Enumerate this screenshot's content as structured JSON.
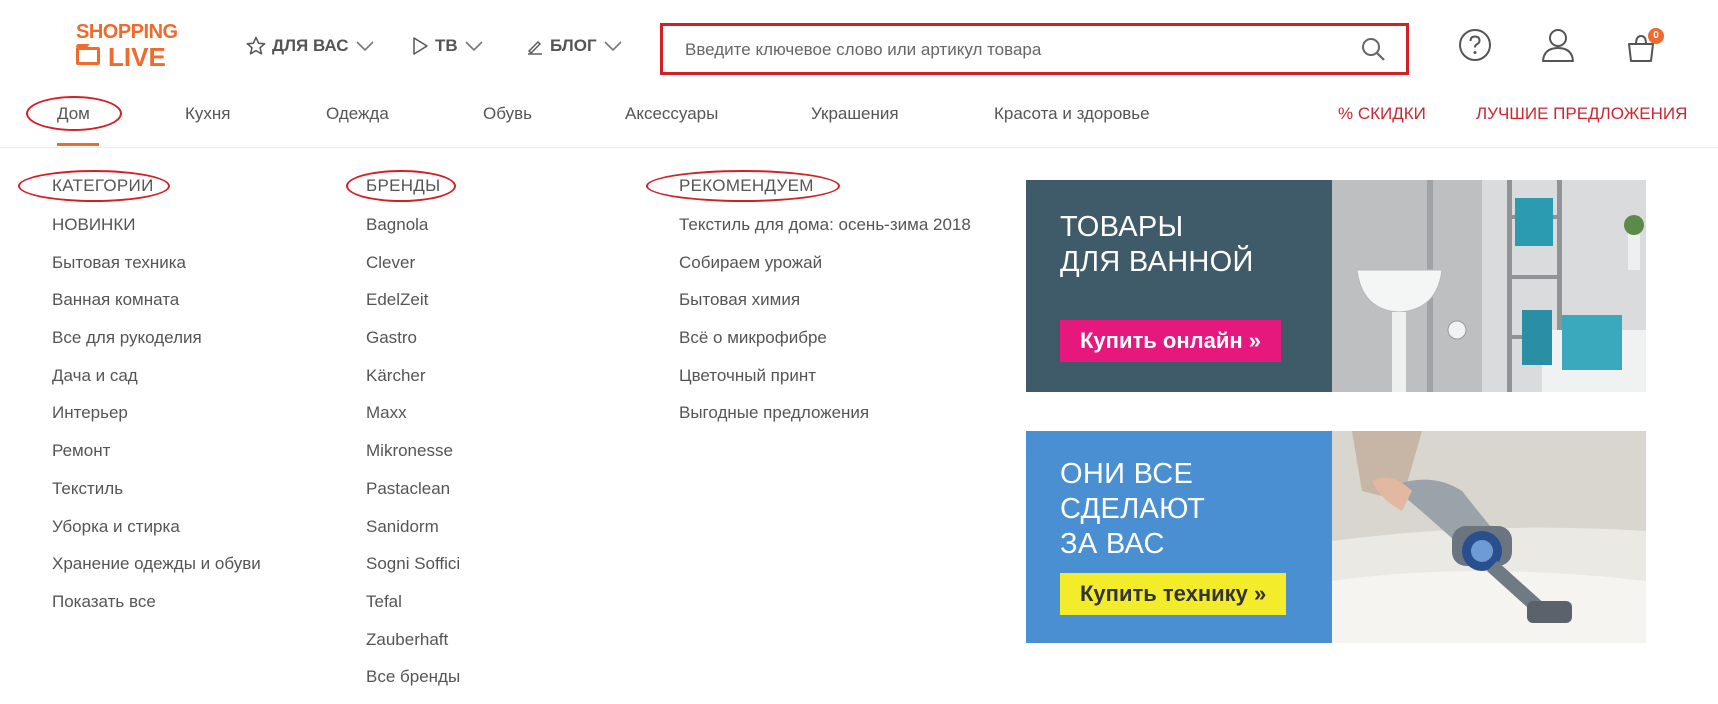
{
  "logo": {
    "line1": "SHOPPING",
    "line2": "LIVE"
  },
  "topnav": [
    {
      "label": "ДЛЯ ВАС",
      "icon": "star-icon"
    },
    {
      "label": "ТВ",
      "icon": "play-icon"
    },
    {
      "label": "БЛОГ",
      "icon": "pencil-icon"
    }
  ],
  "search": {
    "placeholder": "Введите ключевое слово или артикул товара"
  },
  "cart": {
    "count": "0"
  },
  "categories": [
    "Дом",
    "Кухня",
    "Одежда",
    "Обувь",
    "Аксессуары",
    "Украшения",
    "Красота и здоровье"
  ],
  "promo": {
    "discounts": "% СКИДКИ",
    "best": "ЛУЧШИЕ ПРЕДЛОЖЕНИЯ"
  },
  "colors": {
    "accent": "#ee6a2d",
    "promo": "#cc2630",
    "highlight": "#d32027"
  },
  "menu": {
    "categories": {
      "heading": "КАТЕГОРИИ",
      "items": [
        "НОВИНКИ",
        "Бытовая техника",
        "Ванная комната",
        "Все для рукоделия",
        "Дача и сад",
        "Интерьер",
        "Ремонт",
        "Текстиль",
        "Уборка и стирка",
        "Хранение одежды и обуви",
        "Показать все"
      ]
    },
    "brands": {
      "heading": "БРЕНДЫ",
      "items": [
        "Bagnola",
        "Clever",
        "EdelZeit",
        "Gastro",
        "Kärcher",
        "Maxx",
        "Mikronesse",
        "Pastaclean",
        "Sanidorm",
        "Sogni Soffici",
        "Tefal",
        "Zauberhaft",
        "Все бренды"
      ]
    },
    "recommend": {
      "heading": "РЕКОМЕНДУЕМ",
      "items": [
        "Текстиль для дома: осень-зима 2018",
        "Собираем урожай",
        "Бытовая химия",
        "Всё о микрофибре",
        "Цветочный принт",
        "Выгодные предложения"
      ]
    }
  },
  "banners": [
    {
      "line1": "ТОВАРЫ",
      "line2": "ДЛЯ ВАННОЙ",
      "button": "Купить онлайн »"
    },
    {
      "line1": "ОНИ ВСЕ",
      "line2": "СДЕЛАЮТ",
      "line3": "ЗА ВАС",
      "button": "Купить технику »"
    }
  ]
}
